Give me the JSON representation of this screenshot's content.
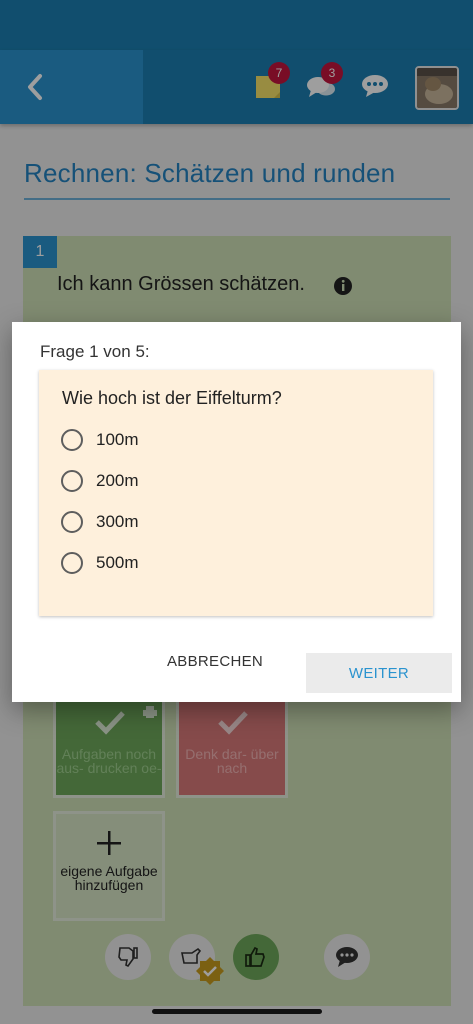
{
  "header": {
    "notes_badge": "7",
    "messages_badge": "3"
  },
  "page": {
    "title": "Rechnen: Schätzen und runden"
  },
  "card": {
    "number": "1",
    "text": "Ich kann Grössen schätzen.",
    "tiles": [
      {
        "label": "Aufgaben noch aus- drucken oe-"
      },
      {
        "label": "Denk dar- über nach"
      }
    ],
    "add_tile_label": "eigene Aufgabe hinzufügen"
  },
  "dialog": {
    "title": "Frage 1 von 5:",
    "question": "Wie hoch ist der Eiffelturm?",
    "options": [
      {
        "label": "100m"
      },
      {
        "label": "200m"
      },
      {
        "label": "300m"
      },
      {
        "label": "500m"
      }
    ],
    "cancel_label": "ABBRECHEN",
    "next_label": "WEITER"
  },
  "colors": {
    "header": "#1c7fb2",
    "accent": "#2a93cf",
    "card_bg": "#cfe0b7",
    "question_bg": "#fef0dc",
    "badge": "#c4163e"
  },
  "icons": [
    "back-chevron-icon",
    "sticky-note-icon",
    "chat-bubbles-icon",
    "speech-bubble-icon",
    "info-icon",
    "checkmark-icon",
    "printer-icon",
    "plus-icon",
    "thumbs-down-icon",
    "thumbs-up-icon",
    "comment-icon"
  ]
}
